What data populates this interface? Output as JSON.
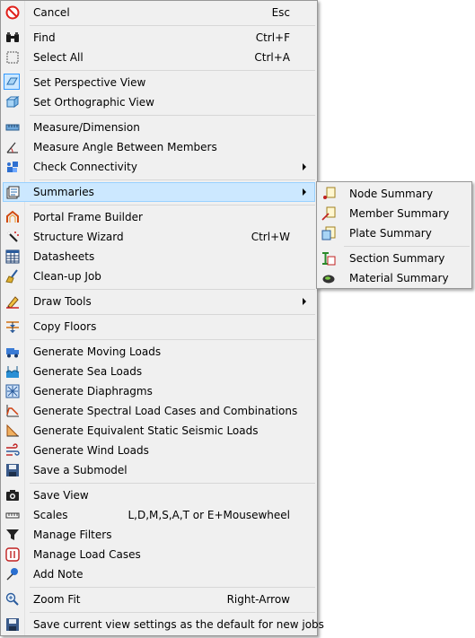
{
  "menu": {
    "cancel": {
      "label": "Cancel",
      "shortcut": "Esc"
    },
    "find": {
      "label": "Find",
      "shortcut": "Ctrl+F"
    },
    "select_all": {
      "label": "Select All",
      "shortcut": "Ctrl+A"
    },
    "perspective": {
      "label": "Set Perspective View"
    },
    "orthographic": {
      "label": "Set Orthographic View"
    },
    "measure": {
      "label": "Measure/Dimension"
    },
    "measure_angle": {
      "label": "Measure Angle Between Members"
    },
    "check_connectivity": {
      "label": "Check Connectivity"
    },
    "summaries": {
      "label": "Summaries"
    },
    "portal_frame": {
      "label": "Portal Frame Builder"
    },
    "structure_wizard": {
      "label": "Structure Wizard",
      "shortcut": "Ctrl+W"
    },
    "datasheets": {
      "label": "Datasheets"
    },
    "cleanup": {
      "label": "Clean-up Job"
    },
    "draw_tools": {
      "label": "Draw Tools"
    },
    "copy_floors": {
      "label": "Copy Floors"
    },
    "moving_loads": {
      "label": "Generate Moving Loads"
    },
    "sea_loads": {
      "label": "Generate Sea Loads"
    },
    "diaphragms": {
      "label": "Generate Diaphragms"
    },
    "spectral": {
      "label": "Generate Spectral Load Cases and Combinations"
    },
    "seismic": {
      "label": "Generate Equivalent Static Seismic Loads"
    },
    "wind": {
      "label": "Generate Wind Loads"
    },
    "submodel": {
      "label": "Save a Submodel"
    },
    "save_view": {
      "label": "Save View"
    },
    "scales": {
      "label": "Scales",
      "shortcut": "L,D,M,S,A,T or E+Mousewheel"
    },
    "filters": {
      "label": "Manage Filters"
    },
    "load_cases": {
      "label": "Manage Load Cases"
    },
    "add_note": {
      "label": "Add Note"
    },
    "zoom_fit": {
      "label": "Zoom Fit",
      "shortcut": "Right-Arrow"
    },
    "save_default": {
      "label": "Save current view settings as the default for new jobs"
    }
  },
  "submenu": {
    "node": "Node Summary",
    "member": "Member Summary",
    "plate": "Plate Summary",
    "section": "Section Summary",
    "material": "Material Summary"
  },
  "colors": {
    "menu_bg": "#f0f0f0",
    "highlight": "#cce8ff",
    "highlight_border": "#99d1ff",
    "checked_border": "#3399ff"
  }
}
